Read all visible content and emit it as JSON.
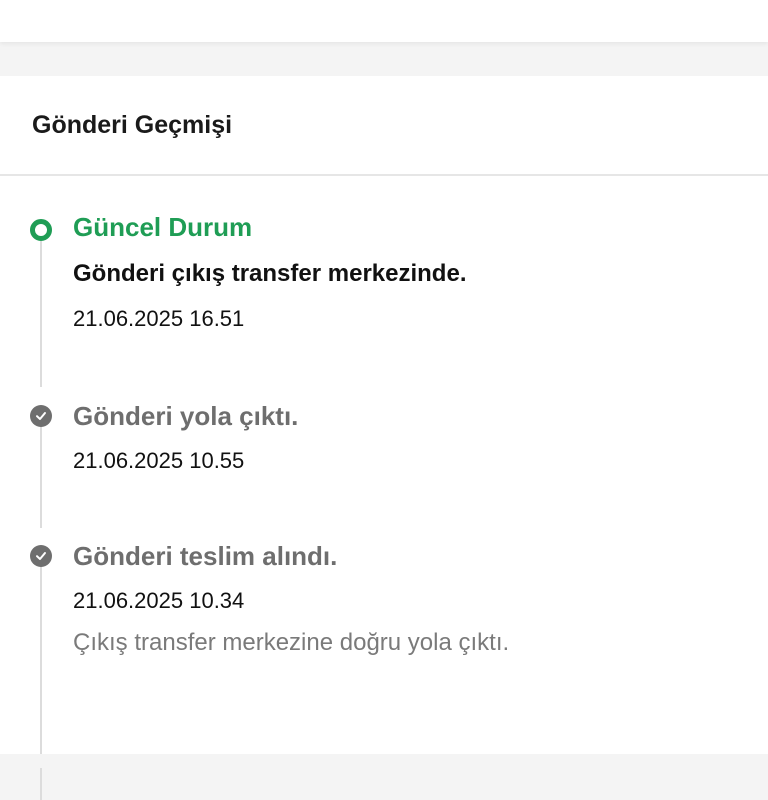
{
  "history": {
    "title": "Gönderi Geçmişi",
    "steps": [
      {
        "status": "Güncel Durum",
        "description": "Gönderi çıkış transfer merkezinde.",
        "time": "21.06.2025 16.51",
        "icon": "current-status-ring-icon",
        "current": true
      },
      {
        "status": "Gönderi yola çıktı.",
        "time": "21.06.2025 10.55",
        "icon": "check-circle-icon",
        "current": false
      },
      {
        "status": "Gönderi teslim alındı.",
        "time": "21.06.2025 10.34",
        "note": "Çıkış transfer merkezine doğru yola çıktı.",
        "icon": "check-circle-icon",
        "current": false
      }
    ]
  },
  "colors": {
    "accent_green": "#1f9d55",
    "done_gray": "#6e6e6e",
    "rail_gray": "#dcdcdc"
  }
}
